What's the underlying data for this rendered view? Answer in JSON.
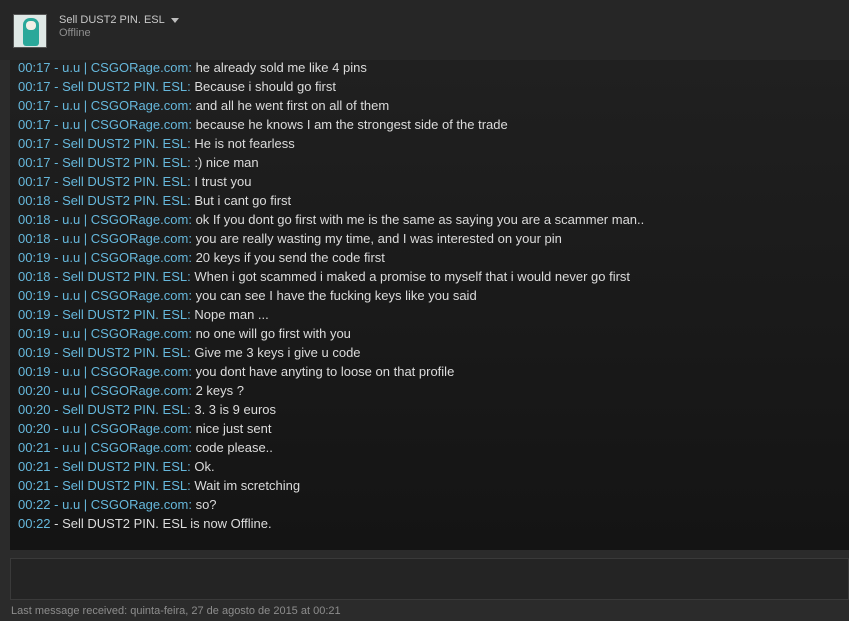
{
  "header": {
    "name": "Sell DUST2 PIN. ESL",
    "status": "Offline"
  },
  "colors": {
    "other_user": "#66b8dc",
    "self_user": "#8fd14f",
    "message_text": "#dcdcdc"
  },
  "messages": [
    {
      "time": "00:17",
      "sender": "u.u | CSGORage.com",
      "text": "he already sold me like 4 pins"
    },
    {
      "time": "00:17",
      "sender": "Sell DUST2 PIN. ESL",
      "text": "Because i should go first"
    },
    {
      "time": "00:17",
      "sender": "u.u | CSGORage.com",
      "text": "and all he went first on all of them"
    },
    {
      "time": "00:17",
      "sender": "u.u | CSGORage.com",
      "text": "because he knows I am the strongest side of the trade"
    },
    {
      "time": "00:17",
      "sender": "Sell DUST2 PIN. ESL",
      "text": "He is not fearless"
    },
    {
      "time": "00:17",
      "sender": "Sell DUST2 PIN. ESL",
      "text": ":) nice man"
    },
    {
      "time": "00:17",
      "sender": "Sell DUST2 PIN. ESL",
      "text": "I trust you"
    },
    {
      "time": "00:18",
      "sender": "Sell DUST2 PIN. ESL",
      "text": "But i cant go first"
    },
    {
      "time": "00:18",
      "sender": "u.u | CSGORage.com",
      "text": "ok If you dont go first with me is the same as saying you are a scammer man.."
    },
    {
      "time": "00:18",
      "sender": "u.u | CSGORage.com",
      "text": "you are really wasting my time, and I was interested on your pin"
    },
    {
      "time": "00:19",
      "sender": "u.u | CSGORage.com",
      "text": "20 keys if you send the code first"
    },
    {
      "time": "00:18",
      "sender": "Sell DUST2 PIN. ESL",
      "text": "When i got scammed i maked a promise to myself that i would never go first"
    },
    {
      "time": "00:19",
      "sender": "u.u | CSGORage.com",
      "text": "you can see I have the fucking keys like you said"
    },
    {
      "time": "00:19",
      "sender": "Sell DUST2 PIN. ESL",
      "text": "Nope man ..."
    },
    {
      "time": "00:19",
      "sender": "u.u | CSGORage.com",
      "text": "no one will go first with you"
    },
    {
      "time": "00:19",
      "sender": "Sell DUST2 PIN. ESL",
      "text": "Give me 3 keys i give u code"
    },
    {
      "time": "00:19",
      "sender": "u.u | CSGORage.com",
      "text": "you dont have anyting to loose on that profile"
    },
    {
      "time": "00:20",
      "sender": "u.u | CSGORage.com",
      "text": "2 keys ?"
    },
    {
      "time": "00:20",
      "sender": "Sell DUST2 PIN. ESL",
      "text": "3. 3 is 9 euros"
    },
    {
      "time": "00:20",
      "sender": "u.u | CSGORage.com",
      "text": "nice just sent"
    },
    {
      "time": "00:21",
      "sender": "u.u | CSGORage.com",
      "text": "code please.."
    },
    {
      "time": "00:21",
      "sender": "Sell DUST2 PIN. ESL",
      "text": "Ok."
    },
    {
      "time": "00:21",
      "sender": "Sell DUST2 PIN. ESL",
      "text": "Wait im scretching"
    },
    {
      "time": "00:22",
      "sender": "u.u | CSGORage.com",
      "text": "so?"
    }
  ],
  "system_message": {
    "time": "00:22",
    "text": "Sell DUST2 PIN. ESL is now Offline."
  },
  "input": {
    "value": "",
    "placeholder": ""
  },
  "footer": {
    "last_message": "Last message received: quinta-feira, 27 de agosto de 2015 at 00:21"
  }
}
